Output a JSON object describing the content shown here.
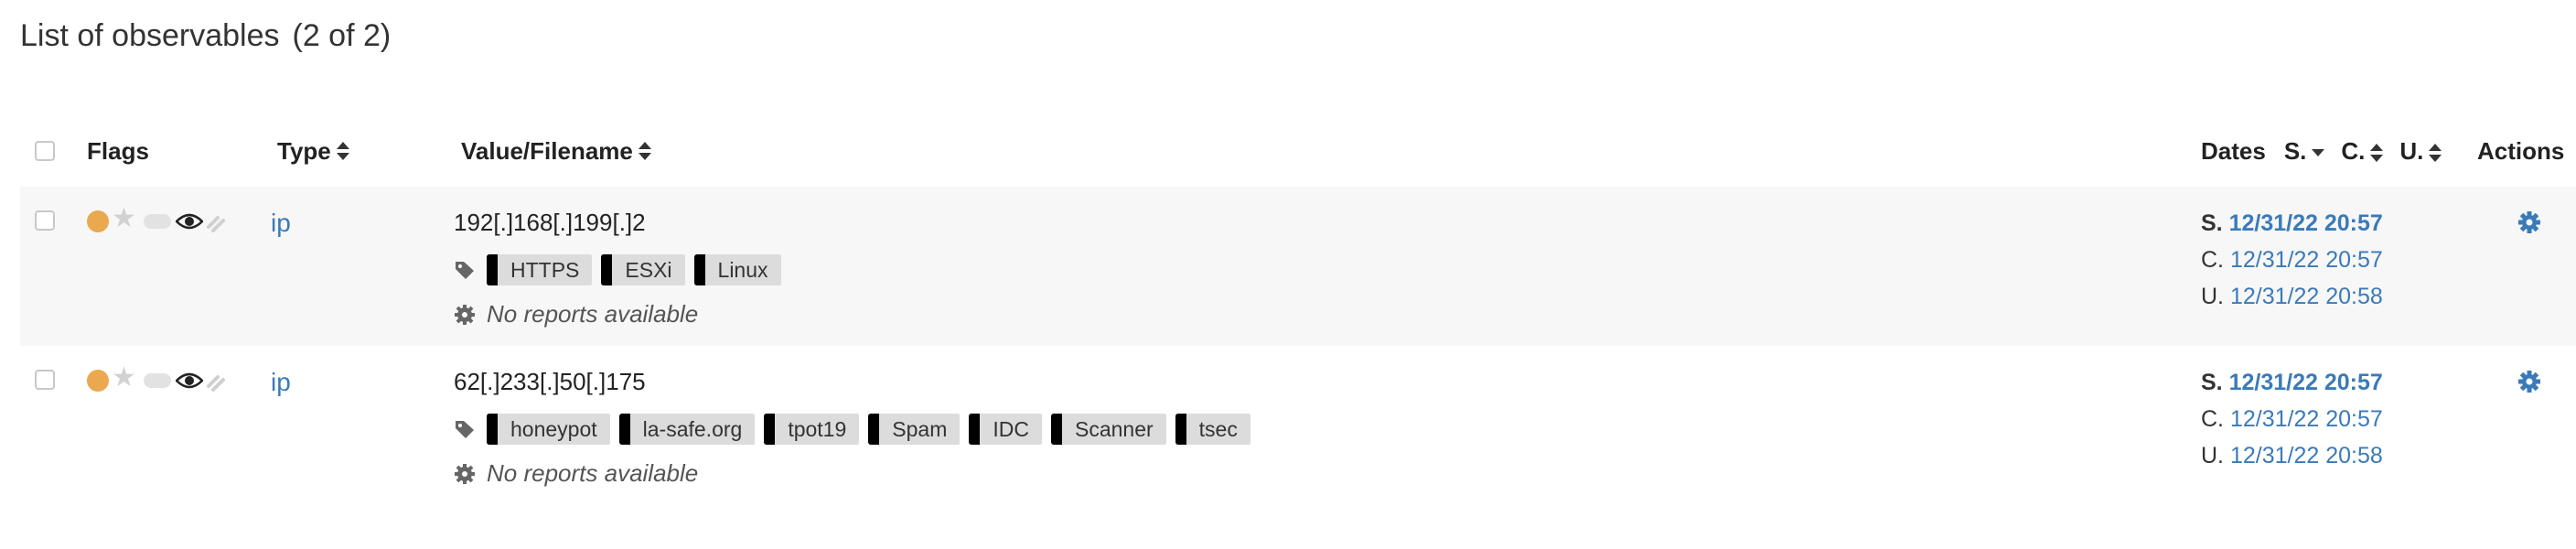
{
  "page": {
    "title": "List of observables",
    "count": "(2 of 2)"
  },
  "table": {
    "headers": {
      "flags": "Flags",
      "type": "Type",
      "value": "Value/Filename",
      "dates": "Dates",
      "s": "S.",
      "c": "C.",
      "u": "U.",
      "actions": "Actions"
    },
    "rows": [
      {
        "type": "ip",
        "value": "192[.]168[.]199[.]2",
        "tags": [
          "HTTPS",
          "ESXi",
          "Linux"
        ],
        "reports": "No reports available",
        "dates": {
          "s_label": "S.",
          "s": "12/31/22 20:57",
          "c_label": "C.",
          "c": "12/31/22 20:57",
          "u_label": "U.",
          "u": "12/31/22 20:58"
        }
      },
      {
        "type": "ip",
        "value": "62[.]233[.]50[.]175",
        "tags": [
          "honeypot",
          "la-safe.org",
          "tpot19",
          "Spam",
          "IDC",
          "Scanner",
          "tsec"
        ],
        "reports": "No reports available",
        "dates": {
          "s_label": "S.",
          "s": "12/31/22 20:57",
          "c_label": "C.",
          "c": "12/31/22 20:57",
          "u_label": "U.",
          "u": "12/31/22 20:58"
        }
      }
    ]
  },
  "colors": {
    "link": "#3a7ab8",
    "flag_dot": "#eaa84f",
    "row_alt": "#f7f7f7",
    "tag_bg": "#dcdcdc"
  },
  "icons": {
    "tags": "tags-icon",
    "report": "gear-icon",
    "action": "cog-icon",
    "flag": "eye-icon"
  }
}
